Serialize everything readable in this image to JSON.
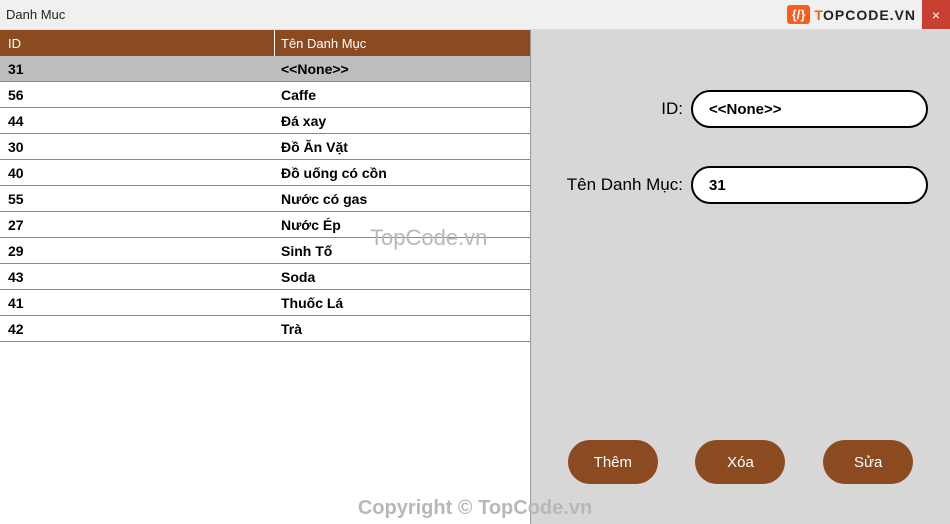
{
  "window": {
    "title": "Danh Muc",
    "logo_text_t": "T",
    "logo_text_rest": "OPCODE.VN",
    "logo_box": "{/}",
    "close": "×"
  },
  "grid": {
    "headers": {
      "id": "ID",
      "name": "Tên Danh Mục"
    },
    "rows": [
      {
        "id": "31",
        "name": "<<None>>",
        "selected": true
      },
      {
        "id": "56",
        "name": "Caffe"
      },
      {
        "id": "44",
        "name": "Đá xay"
      },
      {
        "id": "30",
        "name": "Đồ Ăn Vặt"
      },
      {
        "id": "40",
        "name": "Đồ uống có cồn"
      },
      {
        "id": "55",
        "name": "Nước có gas"
      },
      {
        "id": "27",
        "name": "Nước Ép"
      },
      {
        "id": "29",
        "name": "Sinh Tố"
      },
      {
        "id": "43",
        "name": "Soda"
      },
      {
        "id": "41",
        "name": "Thuốc Lá"
      },
      {
        "id": "42",
        "name": "Trà"
      }
    ]
  },
  "form": {
    "id_label": "ID:",
    "id_value": "<<None>>",
    "name_label": "Tên Danh Mục:",
    "name_value": "31"
  },
  "buttons": {
    "add": "Thêm",
    "delete": "Xóa",
    "edit": "Sửa"
  },
  "watermark": {
    "center": "TopCode.vn",
    "bottom": "Copyright © TopCode.vn"
  }
}
